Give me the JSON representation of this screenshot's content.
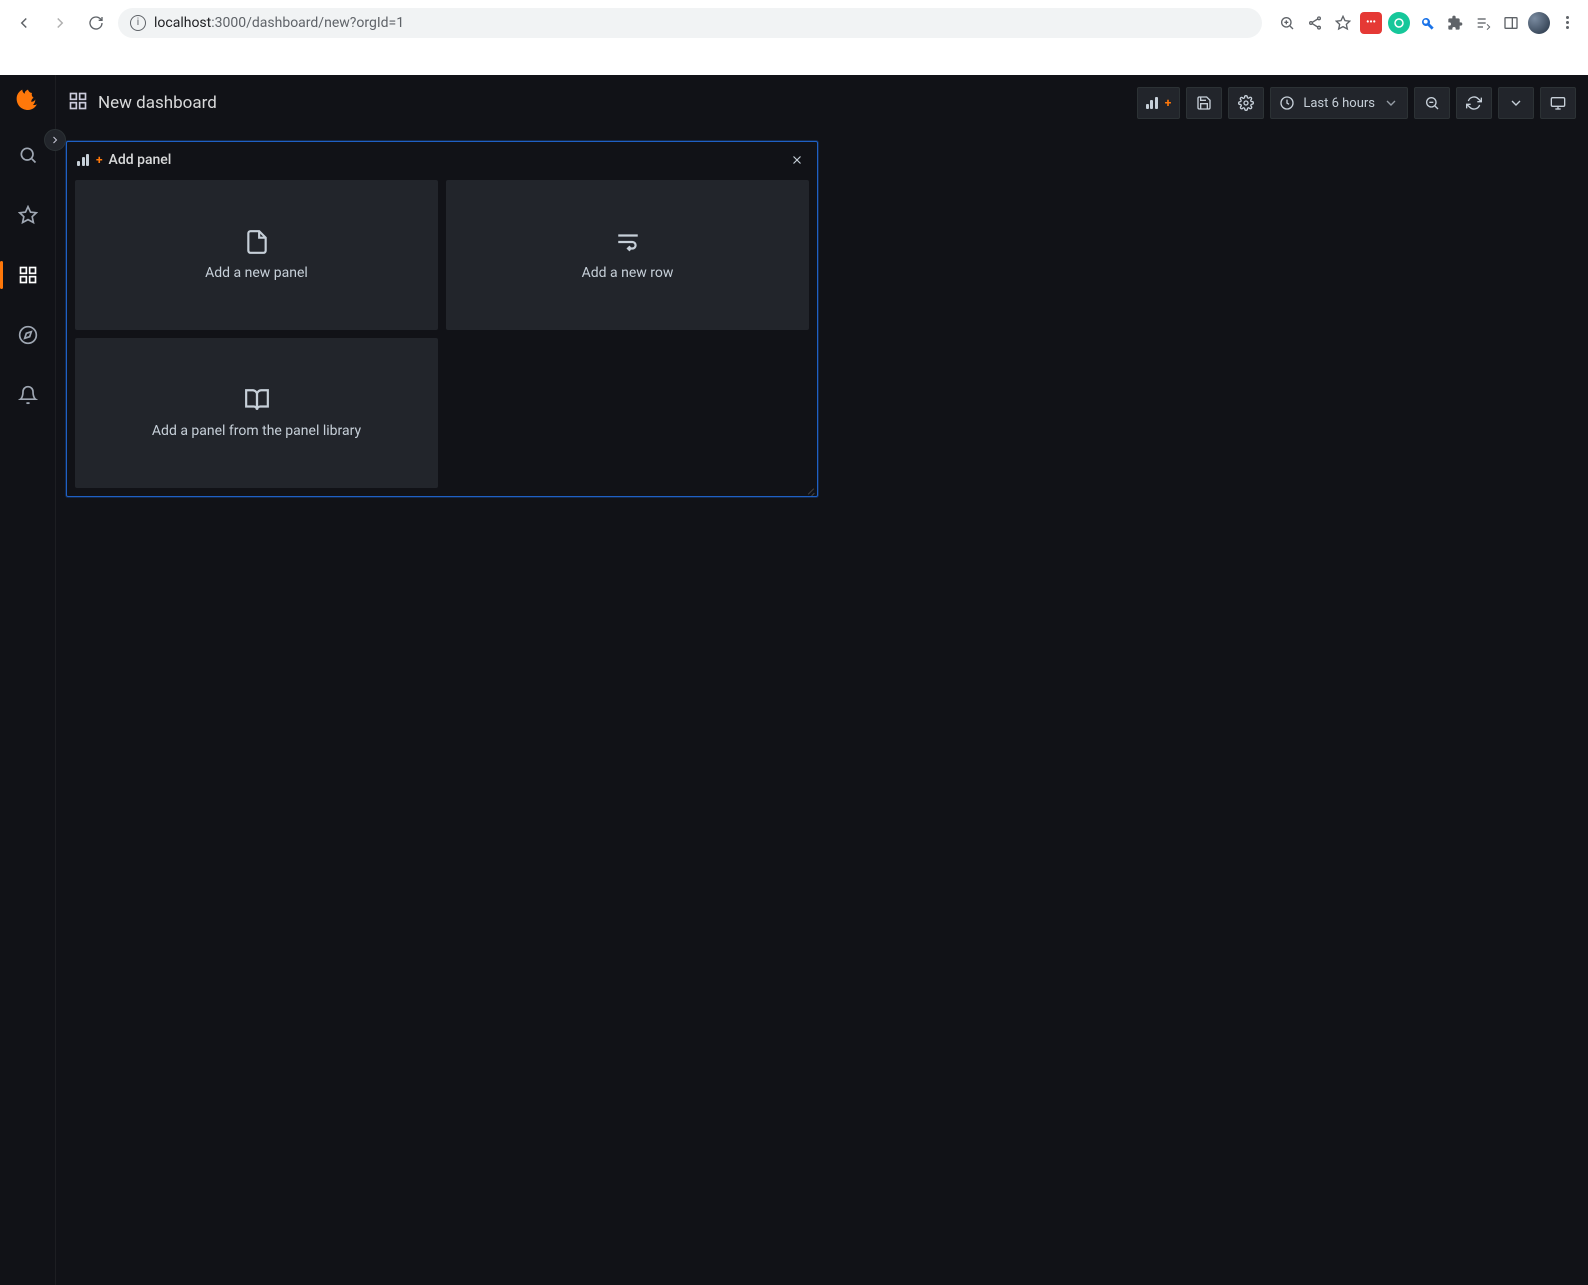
{
  "browser": {
    "url_host": "localhost",
    "url_port_path": ":3000/dashboard/new?orgId=1"
  },
  "sidenav": {
    "items": [
      {
        "id": "search"
      },
      {
        "id": "starred"
      },
      {
        "id": "dashboards"
      },
      {
        "id": "explore"
      },
      {
        "id": "alerting"
      }
    ]
  },
  "toolbar": {
    "page_title": "New dashboard",
    "time_range": "Last 6 hours"
  },
  "add_panel": {
    "title": "Add panel",
    "cards": {
      "new_panel": "Add a new panel",
      "new_row": "Add a new row",
      "from_library": "Add a panel from the panel library"
    }
  }
}
